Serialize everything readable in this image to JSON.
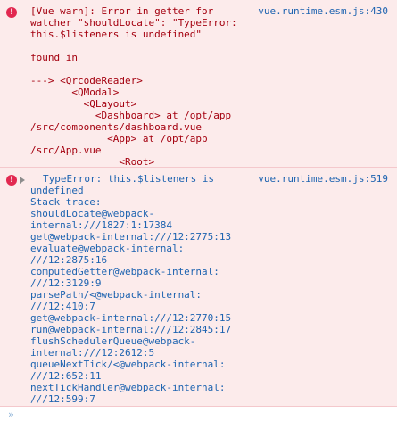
{
  "console": {
    "entries": [
      {
        "icon": "error-icon",
        "source": "vue.runtime.esm.js:430",
        "message": "[Vue warn]: Error in getter for\nwatcher \"shouldLocate\": \"TypeError:\nthis.$listeners is undefined\"\n\nfound in\n\n---> <QrcodeReader>\n       <QModal>\n         <QLayout>\n           <Dashboard> at /opt/app\n/src/components/dashboard.vue\n             <App> at /opt/app\n/src/App.vue\n               <Root>"
      },
      {
        "icon": "error-icon",
        "source": "vue.runtime.esm.js:519",
        "message": "TypeError: this.$listeners is",
        "message_cont": "undefined",
        "stack": "Stack trace:\nshouldLocate@webpack-\ninternal:///1827:1:17384\nget@webpack-internal:///12:2775:13\nevaluate@webpack-internal:\n///12:2875:16\ncomputedGetter@webpack-internal:\n///12:3129:9\nparsePath/<@webpack-internal:\n///12:410:7\nget@webpack-internal:///12:2770:15\nrun@webpack-internal:///12:2845:17\nflushSchedulerQueue@webpack-\ninternal:///12:2612:5\nqueueNextTick/<@webpack-internal:\n///12:652:11\nnextTickHandler@webpack-internal:\n///12:599:7"
      }
    ],
    "prompt": {
      "chevron": "»",
      "placeholder": ""
    }
  }
}
